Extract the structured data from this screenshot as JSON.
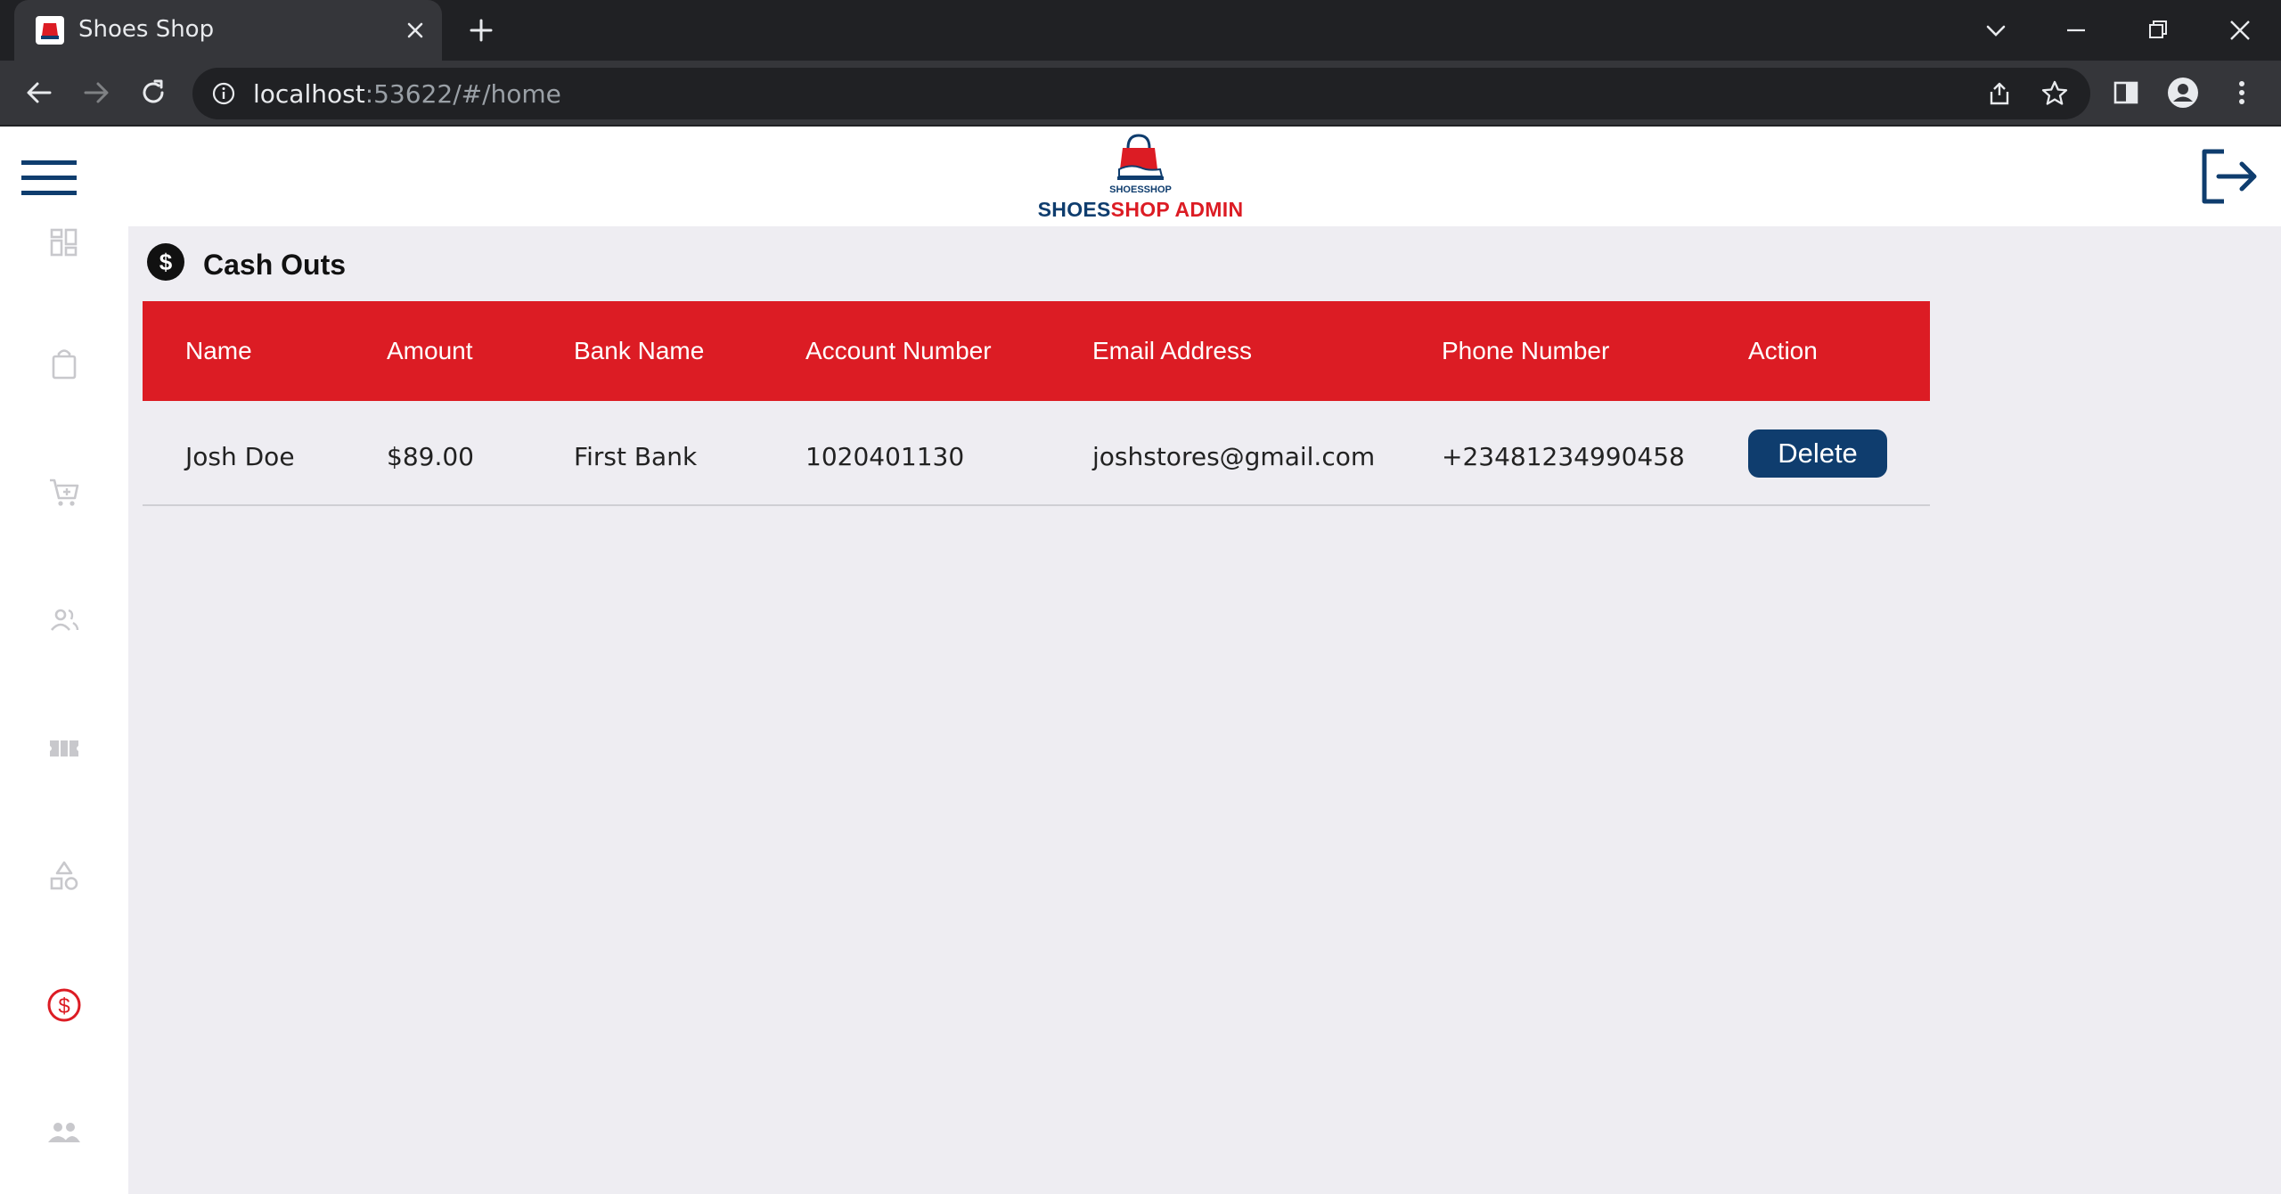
{
  "browser": {
    "tab_title": "Shoes Shop",
    "url_host": "localhost",
    "url_rest": ":53622/#/home"
  },
  "header": {
    "logo_text": "SHOESSHOP",
    "brand_part1": "SHOES",
    "brand_part2": "SHOP ADMIN"
  },
  "colors": {
    "brand_red": "#dc1c24",
    "brand_navy": "#0f3d6e",
    "sidebar_icon": "#c8c8cc"
  },
  "sidebar": {
    "items": [
      {
        "icon": "dashboard-icon",
        "active": false
      },
      {
        "icon": "shopping-bag-icon",
        "active": false
      },
      {
        "icon": "cart-icon",
        "active": false
      },
      {
        "icon": "users-icon",
        "active": false
      },
      {
        "icon": "ticket-icon",
        "active": false
      },
      {
        "icon": "categories-icon",
        "active": false
      },
      {
        "icon": "cashout-icon",
        "active": true
      },
      {
        "icon": "group-icon",
        "active": false
      }
    ]
  },
  "page": {
    "title": "Cash Outs",
    "icon": "dollar-circle-icon"
  },
  "table": {
    "columns": [
      "Name",
      "Amount",
      "Bank Name",
      "Account Number",
      "Email Address",
      "Phone Number",
      "Action"
    ],
    "rows": [
      {
        "name": "Josh Doe",
        "amount": "$89.00",
        "bank_name": "First Bank",
        "account_number": "1020401130",
        "email": "joshstores@gmail.com",
        "phone": "+23481234990458",
        "action_label": "Delete"
      }
    ]
  }
}
